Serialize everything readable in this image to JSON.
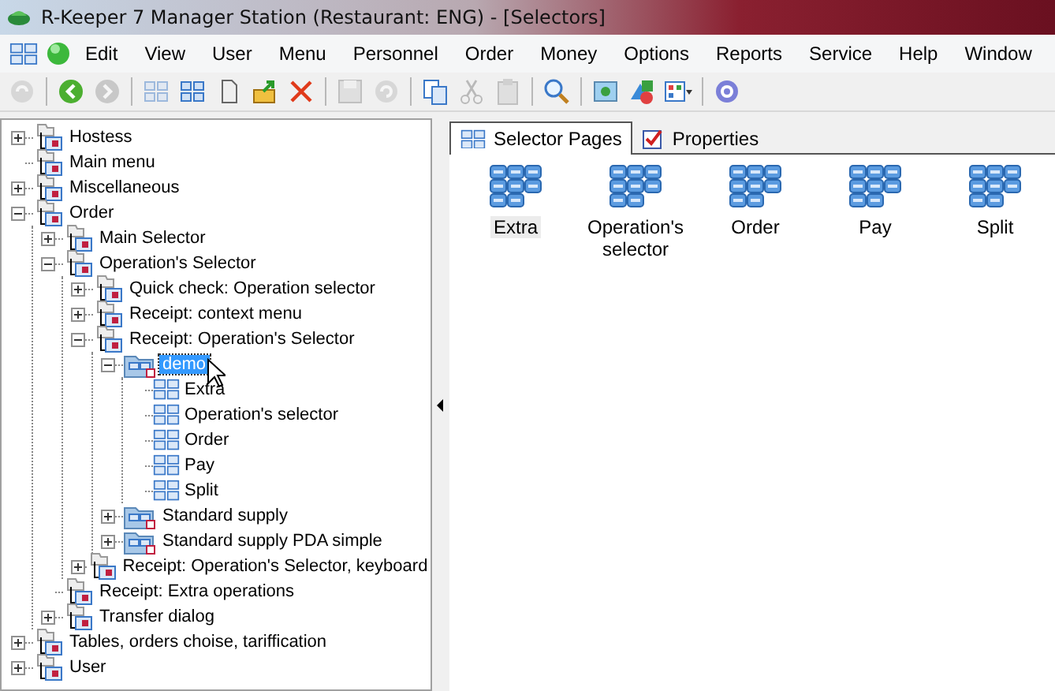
{
  "window": {
    "title": "R-Keeper 7 Manager Station (Restaurant: ENG) - [Selectors]"
  },
  "menu": [
    "Edit",
    "View",
    "User",
    "Menu",
    "Personnel",
    "Order",
    "Money",
    "Options",
    "Reports",
    "Service",
    "Help",
    "Window"
  ],
  "toolbar": [
    {
      "kind": "refresh",
      "disabled": true
    },
    {
      "kind": "sep"
    },
    {
      "kind": "back",
      "disabled": false
    },
    {
      "kind": "forward",
      "disabled": true
    },
    {
      "kind": "sep"
    },
    {
      "kind": "grid",
      "disabled": true
    },
    {
      "kind": "grid",
      "disabled": false
    },
    {
      "kind": "doc",
      "disabled": false
    },
    {
      "kind": "export",
      "disabled": false
    },
    {
      "kind": "delete",
      "disabled": false
    },
    {
      "kind": "sep"
    },
    {
      "kind": "save",
      "disabled": true
    },
    {
      "kind": "undo",
      "disabled": true
    },
    {
      "kind": "sep"
    },
    {
      "kind": "copy",
      "disabled": false
    },
    {
      "kind": "cut",
      "disabled": true
    },
    {
      "kind": "paste",
      "disabled": true
    },
    {
      "kind": "sep"
    },
    {
      "kind": "search",
      "disabled": false
    },
    {
      "kind": "sep"
    },
    {
      "kind": "image",
      "disabled": false
    },
    {
      "kind": "shapes",
      "disabled": false
    },
    {
      "kind": "table",
      "disabled": false
    },
    {
      "kind": "sep"
    },
    {
      "kind": "gear",
      "disabled": false
    }
  ],
  "tree": [
    {
      "label": "Hostess",
      "kind": "folder",
      "expanded": false,
      "selected": false
    },
    {
      "label": "Main menu",
      "kind": "folder",
      "selected": false
    },
    {
      "label": "Miscellaneous",
      "kind": "folder",
      "expanded": false,
      "selected": false
    },
    {
      "label": "Order",
      "kind": "folder",
      "expanded": true,
      "selected": false,
      "children": [
        {
          "label": "Main Selector",
          "kind": "folder",
          "expanded": false,
          "selected": false
        },
        {
          "label": "Operation's Selector",
          "kind": "folder",
          "expanded": true,
          "selected": false,
          "children": [
            {
              "label": "Quick check: Operation selector",
              "kind": "folder",
              "expanded": false,
              "selected": false
            },
            {
              "label": "Receipt: context menu",
              "kind": "folder",
              "expanded": false,
              "selected": false
            },
            {
              "label": "Receipt: Operation's Selector",
              "kind": "folder",
              "expanded": true,
              "selected": false,
              "children": [
                {
                  "label": "demo",
                  "kind": "selector",
                  "expanded": true,
                  "selected": true,
                  "children": [
                    {
                      "label": "Extra",
                      "kind": "page",
                      "selected": false
                    },
                    {
                      "label": "Operation's selector",
                      "kind": "page",
                      "selected": false
                    },
                    {
                      "label": "Order",
                      "kind": "page",
                      "selected": false
                    },
                    {
                      "label": "Pay",
                      "kind": "page",
                      "selected": false
                    },
                    {
                      "label": "Split",
                      "kind": "page",
                      "selected": false
                    }
                  ]
                },
                {
                  "label": "Standard supply",
                  "kind": "selector",
                  "expanded": false,
                  "selected": false
                },
                {
                  "label": "Standard supply PDA simple",
                  "kind": "selector",
                  "expanded": false,
                  "selected": false
                }
              ]
            },
            {
              "label": "Receipt: Operation's Selector, keyboard",
              "kind": "folder",
              "expanded": false,
              "selected": false
            }
          ]
        },
        {
          "label": "Receipt: Extra operations",
          "kind": "folder",
          "selected": false
        },
        {
          "label": "Transfer dialog",
          "kind": "folder",
          "expanded": false,
          "selected": false
        }
      ]
    },
    {
      "label": "Tables, orders choise, tariffication",
      "kind": "folder",
      "expanded": false,
      "selected": false
    },
    {
      "label": "User",
      "kind": "folder",
      "expanded": false,
      "selected": false
    }
  ],
  "tabs": [
    {
      "label": "Selector Pages",
      "kind": "pages",
      "selected": true
    },
    {
      "label": "Properties",
      "kind": "properties",
      "selected": false
    }
  ],
  "pages": [
    {
      "label": "Extra",
      "selected": true
    },
    {
      "label": "Operation's selector",
      "selected": false
    },
    {
      "label": "Order",
      "selected": false
    },
    {
      "label": "Pay",
      "selected": false
    },
    {
      "label": "Split",
      "selected": false
    }
  ]
}
